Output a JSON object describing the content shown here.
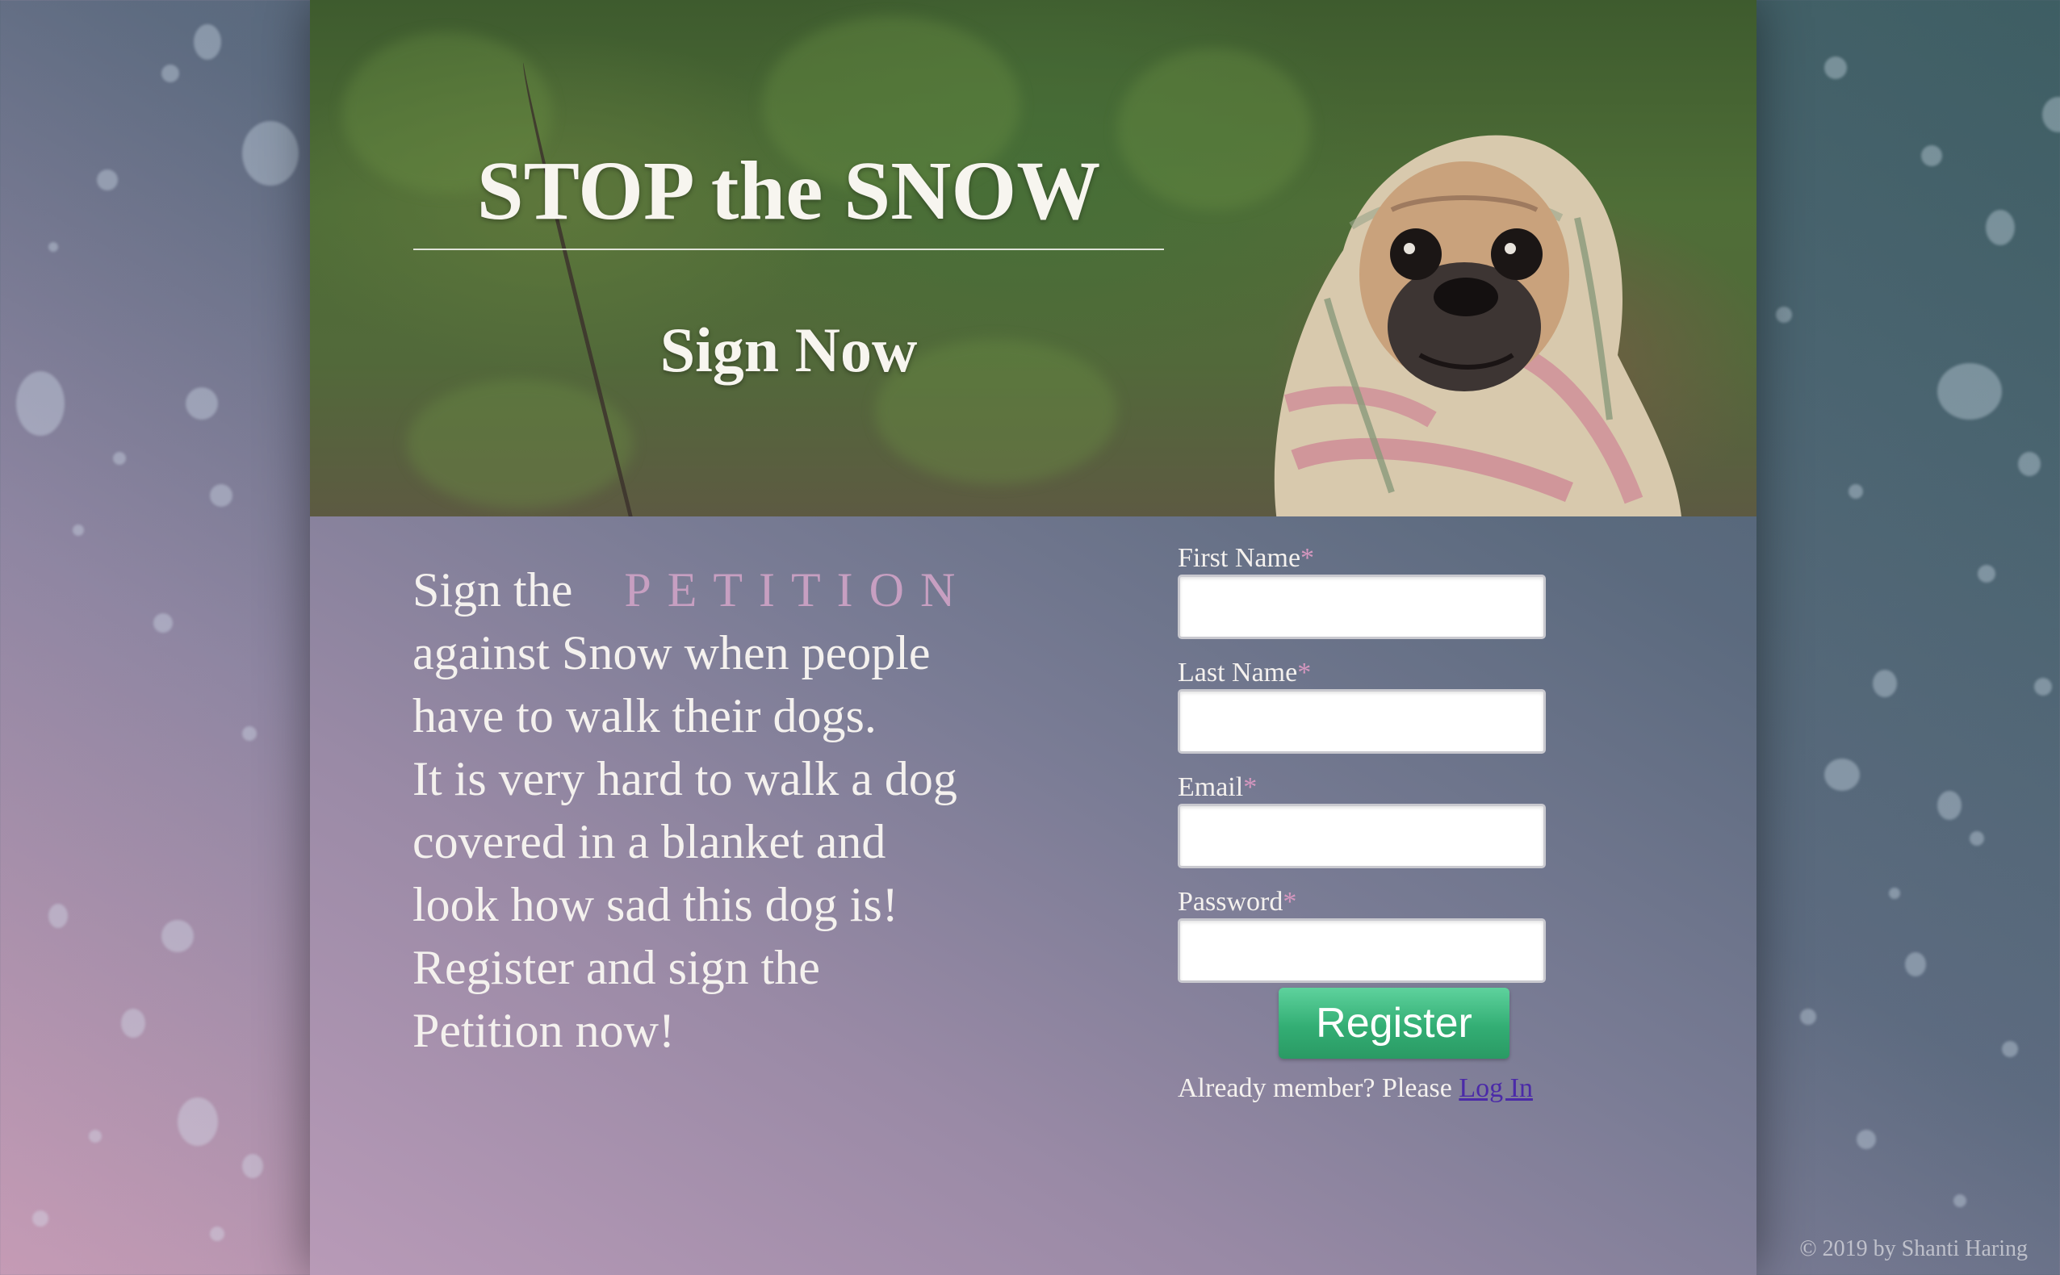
{
  "hero": {
    "title": "STOP the SNOW",
    "subtitle": "Sign Now"
  },
  "pitch": {
    "lead": "Sign the",
    "highlight": "PETITION",
    "lines": [
      "against Snow when people",
      "have to walk their dogs.",
      "It is very hard to walk a dog",
      "covered in a blanket and",
      "look how sad this dog is!",
      "Register and sign the",
      "Petition now!"
    ]
  },
  "form": {
    "fields": [
      {
        "label": "First Name",
        "value": "",
        "required_mark": "*"
      },
      {
        "label": "Last Name",
        "value": "",
        "required_mark": "*"
      },
      {
        "label": "Email",
        "value": "",
        "required_mark": "*"
      },
      {
        "label": "Password",
        "value": "",
        "required_mark": "*"
      }
    ],
    "submit_label": "Register",
    "already_text": "Already member? Please",
    "login_link": "Log In"
  },
  "footer": {
    "copyright": "© 2019 by Shanti Haring"
  },
  "colors": {
    "accent_pink": "#c79fc1",
    "required_mark": "#d597bf",
    "button_green": "#33ae74",
    "link_purple": "#4b2aa8"
  },
  "images": {
    "hero_photo": "pug-wrapped-in-blanket-photo"
  }
}
